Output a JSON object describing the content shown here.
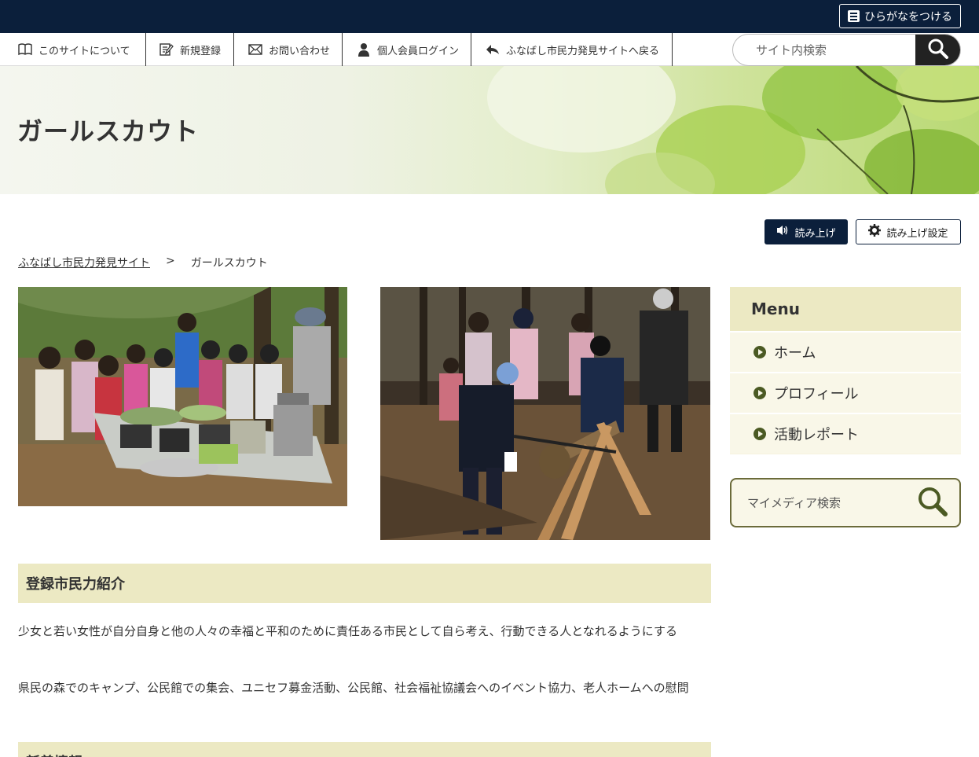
{
  "topbar": {
    "furigana_label": "ひらがなをつける"
  },
  "nav": {
    "items": [
      {
        "label": "このサイトについて",
        "icon": "book-icon"
      },
      {
        "label": "新規登録",
        "icon": "edit-icon"
      },
      {
        "label": "お問い合わせ",
        "icon": "mail-icon"
      },
      {
        "label": "個人会員ログイン",
        "icon": "user-icon"
      },
      {
        "label": "ふなばし市民力発見サイトへ戻る",
        "icon": "return-arrow-icon"
      }
    ],
    "search_placeholder": "サイト内検索"
  },
  "hero": {
    "title": "ガールスカウト"
  },
  "speech": {
    "read_label": "読み上げ",
    "settings_label": "読み上げ設定"
  },
  "breadcrumb": {
    "home": "ふなばし市民力発見サイト",
    "separator": ">",
    "current": "ガールスカウト"
  },
  "main": {
    "section_title": "登録市民力紹介",
    "paragraph1": "少女と若い女性が自分自身と他の人々の幸福と平和のために責任ある市民として自ら考え、行動できる人となれるようにする",
    "paragraph2": "県民の森でのキャンプ、公民館での集会、ユニセフ募金活動、公民館、社会福祉協議会へのイベント協力、老人ホームへの慰問",
    "section2_title": "新着情報"
  },
  "sidebar": {
    "menu_title": "Menu",
    "items": [
      {
        "label": "ホーム"
      },
      {
        "label": "プロフィール"
      },
      {
        "label": "活動レポート"
      }
    ],
    "mymedia_placeholder": "マイメディア検索"
  },
  "colors": {
    "topbar": "#0b1f3b",
    "section_bg": "#ece9c3",
    "menu_bg": "#f6f3de",
    "accent_olive": "#4b5a23"
  }
}
